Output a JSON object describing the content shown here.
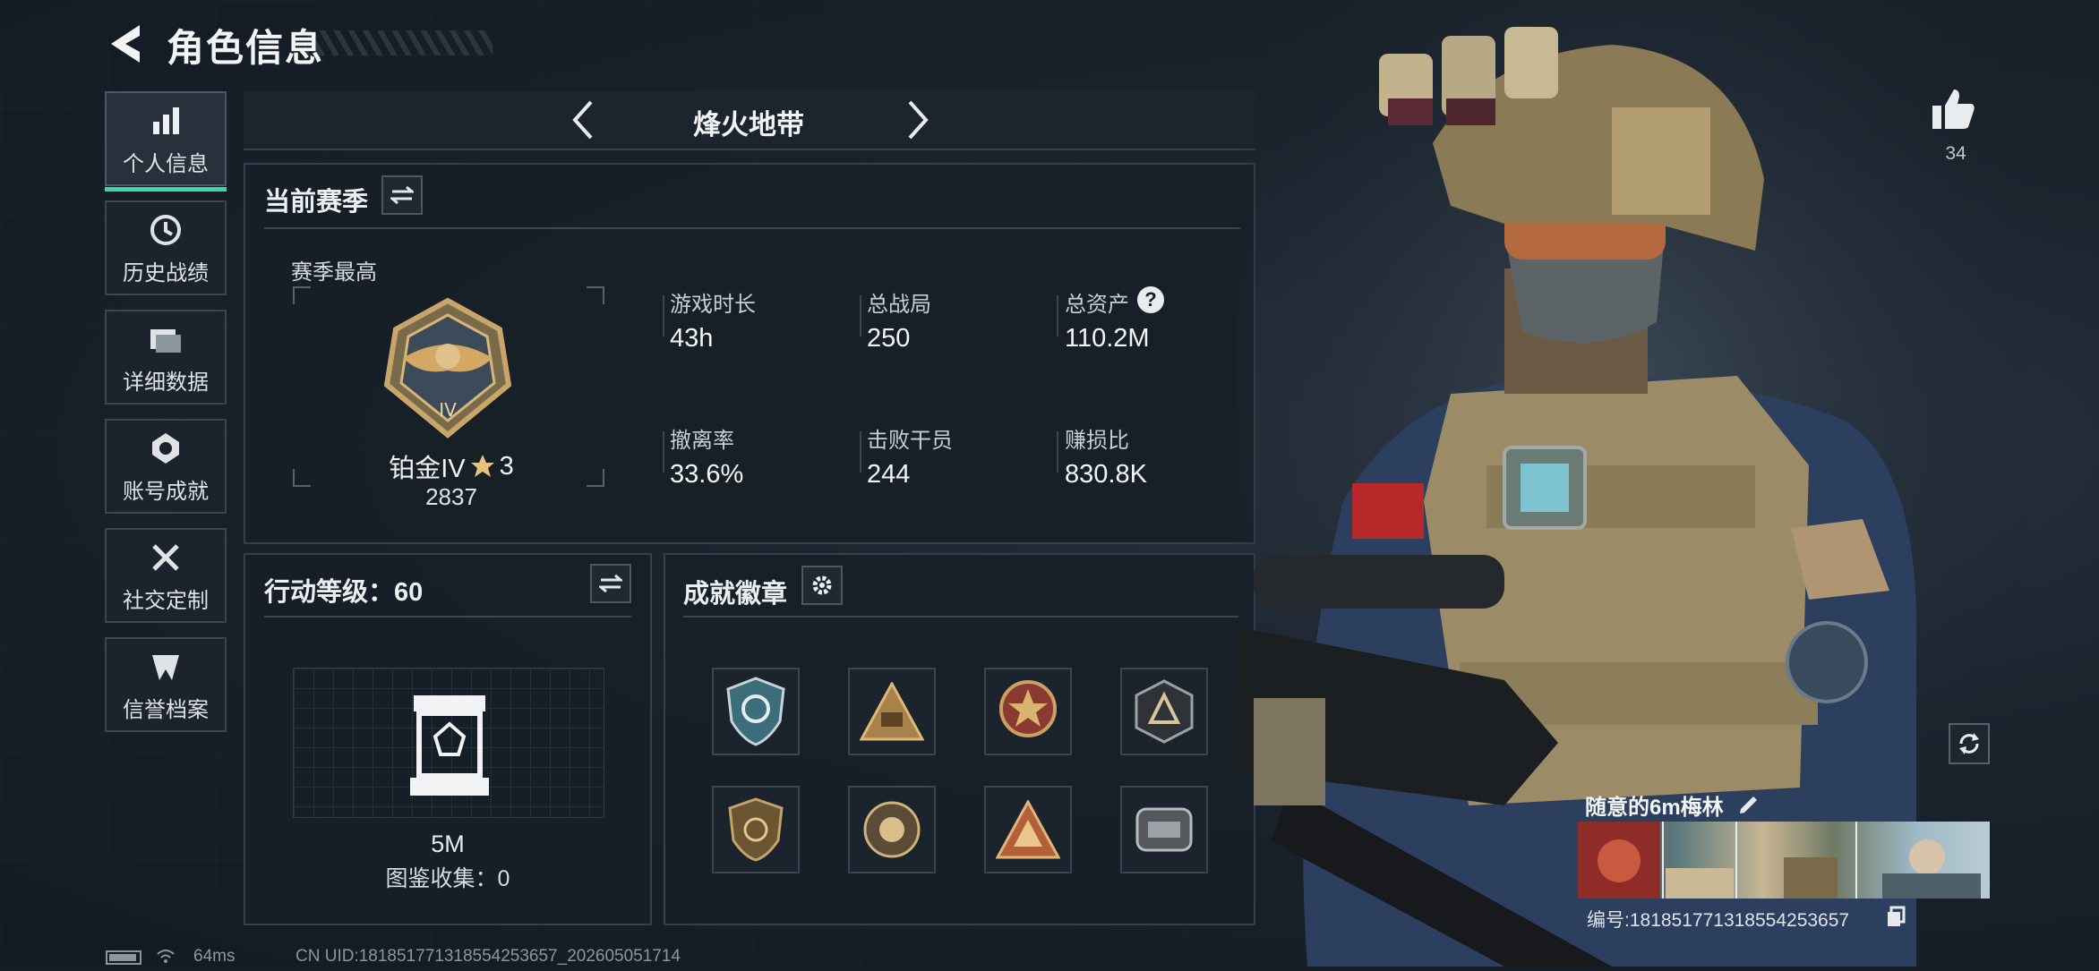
{
  "header": {
    "title": "角色信息"
  },
  "sidebar": {
    "items": [
      {
        "label": "个人信息",
        "icon": "bar-chart-icon",
        "active": true
      },
      {
        "label": "历史战绩",
        "icon": "history-icon"
      },
      {
        "label": "详细数据",
        "icon": "folder-icon"
      },
      {
        "label": "账号成就",
        "icon": "achievement-icon"
      },
      {
        "label": "社交定制",
        "icon": "tools-icon"
      },
      {
        "label": "信誉档案",
        "icon": "credit-icon"
      }
    ]
  },
  "mode": {
    "name": "烽火地带"
  },
  "season": {
    "title": "当前赛季",
    "best_label": "赛季最高",
    "rank_name": "铂金IV",
    "rank_stars": "3",
    "rank_points": "2837",
    "stats": [
      {
        "label": "游戏时长",
        "value": "43h"
      },
      {
        "label": "总战局",
        "value": "250"
      },
      {
        "label": "总资产",
        "value": "110.2M",
        "help": "?"
      },
      {
        "label": "撤离率",
        "value": "33.6%"
      },
      {
        "label": "击败干员",
        "value": "244"
      },
      {
        "label": "赚损比",
        "value": "830.8K"
      }
    ]
  },
  "action_level": {
    "title": "行动等级：60",
    "value": "5M",
    "collection": "图鉴收集：0"
  },
  "badges": {
    "title": "成就徽章",
    "items": [
      "badge-1",
      "badge-2",
      "badge-3",
      "badge-4",
      "badge-5",
      "badge-6",
      "badge-7",
      "badge-8"
    ]
  },
  "profile": {
    "likes": "34",
    "name": "随意的6m梅林",
    "id_label": "编号:18185177131855425365​7"
  },
  "status_bar": {
    "ping": "64ms",
    "uid": "CN UID:18185177131855425365​7_202605051714"
  },
  "colors": {
    "accent": "#3ed6a4",
    "panel_border": "#34404b",
    "background": "#141c24"
  }
}
